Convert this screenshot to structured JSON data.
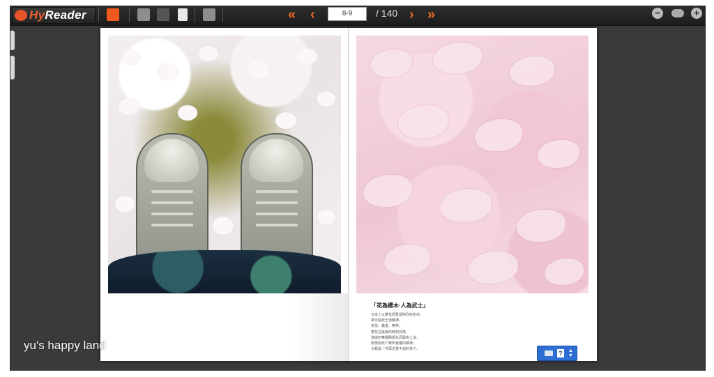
{
  "app": {
    "name_prefix": "Hy",
    "name_suffix": "Reader"
  },
  "navigation": {
    "first": "«",
    "prev": "‹",
    "next": "›",
    "last": "»",
    "current_pages": "8-9",
    "total_pages": "/ 140"
  },
  "zoom": {
    "out": "−",
    "in": "+"
  },
  "page_right": {
    "caption_title": "「花為櫻木·人為武士」",
    "caption_lines": [
      "日本人以櫻花短暫卻熱烈的生命，",
      "來比喻武士道精神，",
      "忠忱、義勇、無常，",
      "櫻花在最美的時刻凋落，",
      "滿城的華麗瞬間化而歸為土沒，",
      "即便對死亡無所畏懼的精神，",
      "大概是一件再次重不過的事了。"
    ]
  },
  "widget": {
    "help": "?"
  },
  "watermark": "yu's happy land"
}
